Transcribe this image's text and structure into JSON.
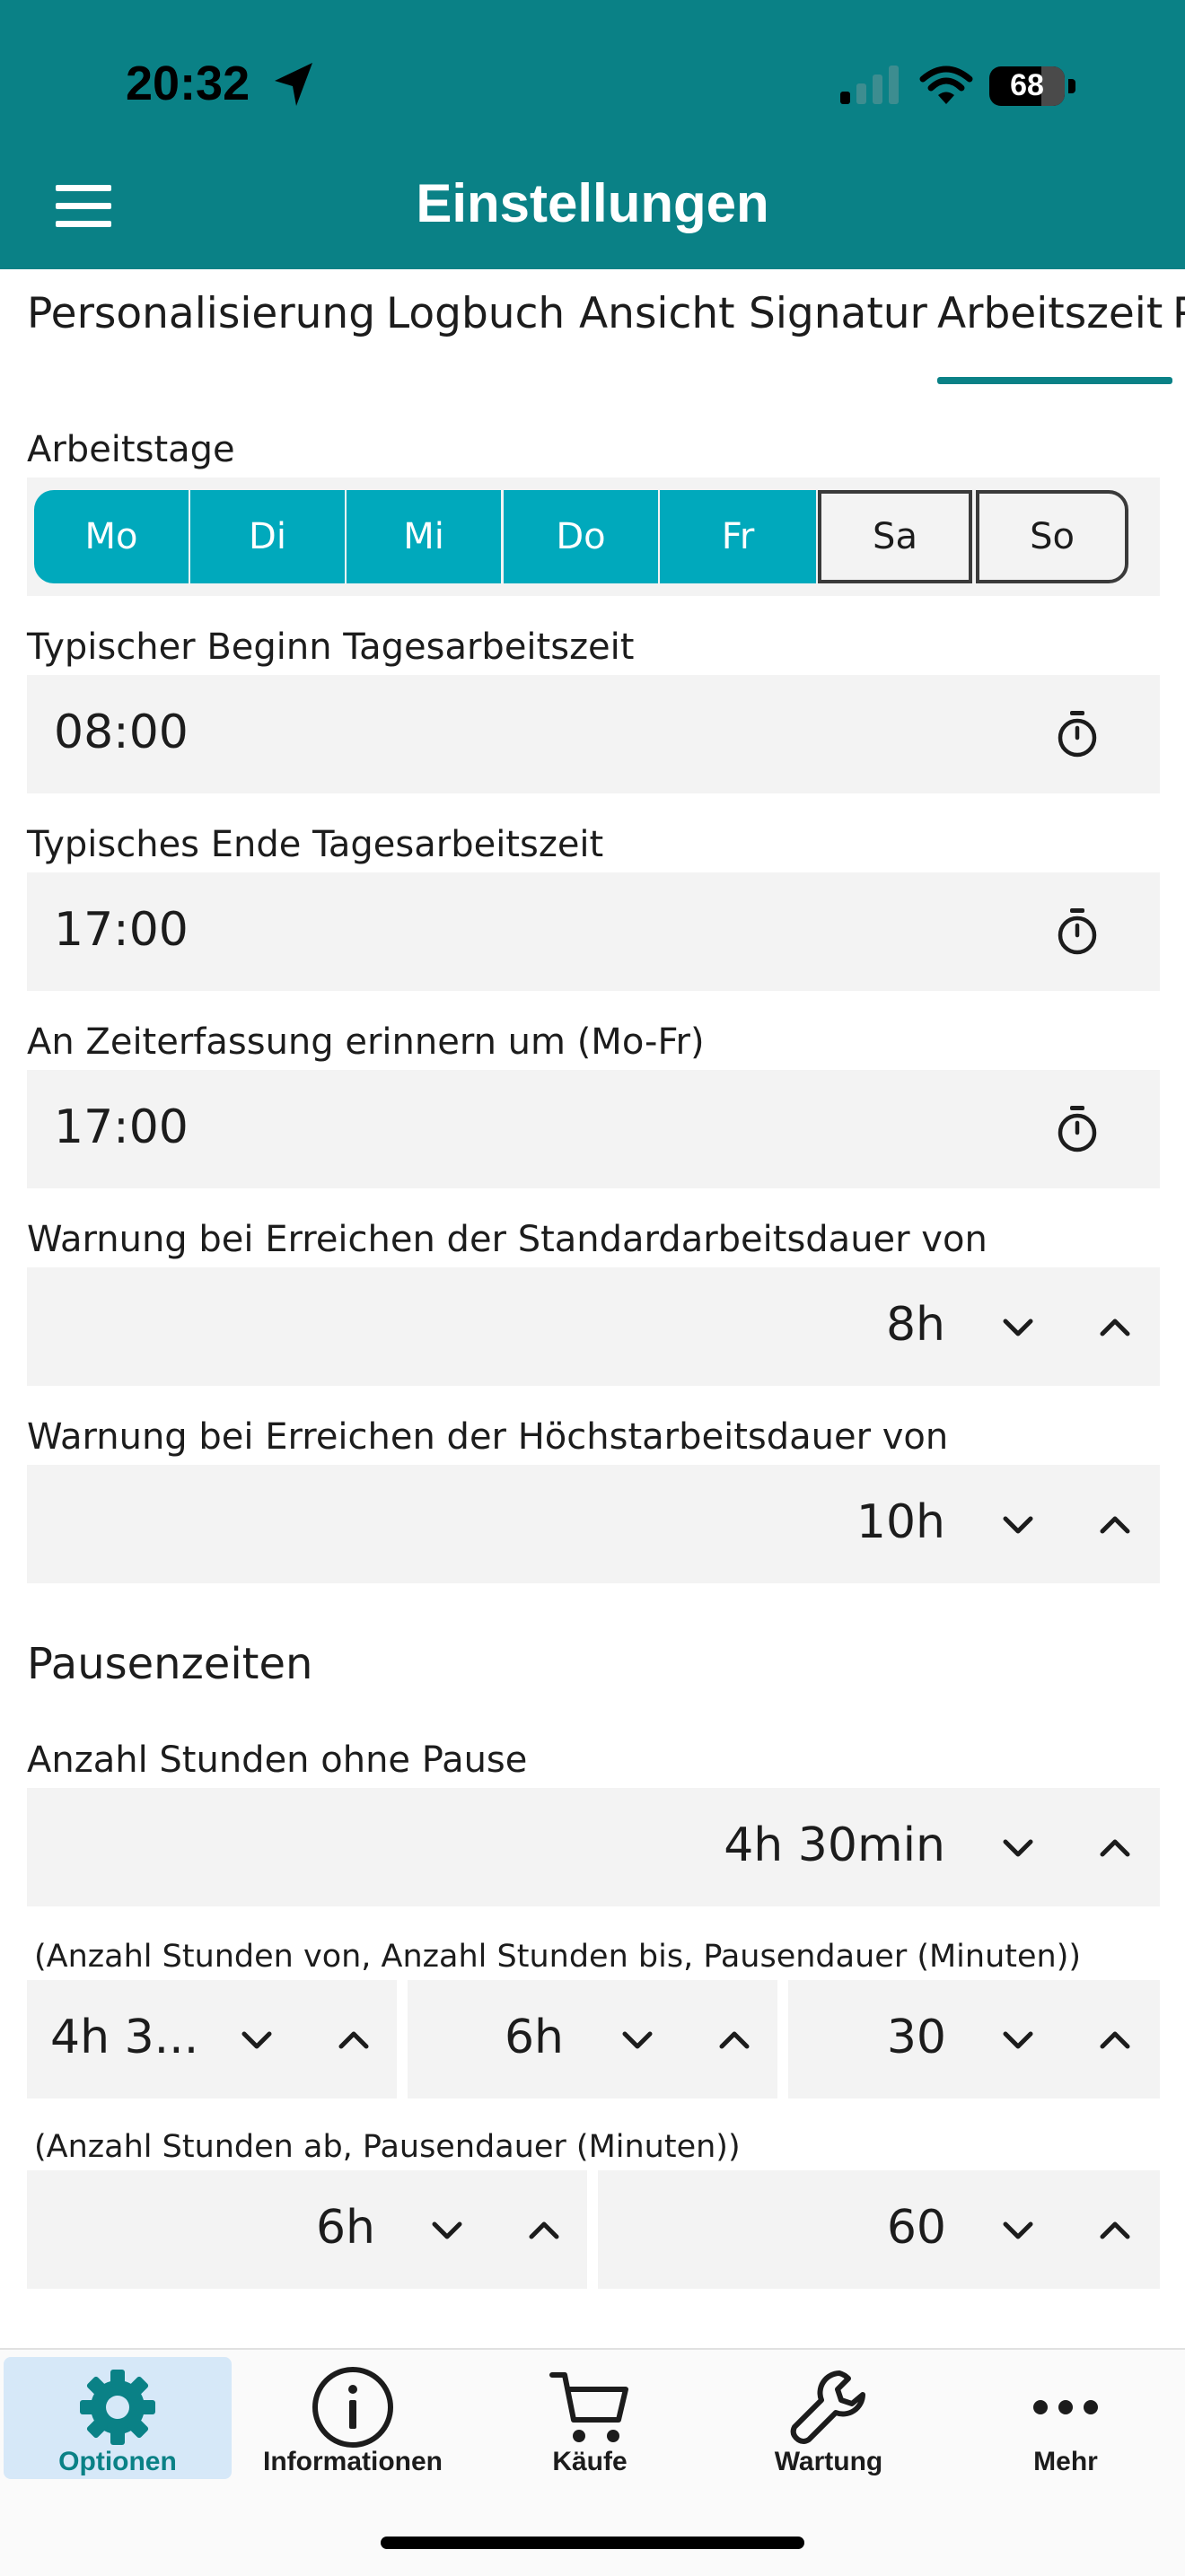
{
  "status_bar": {
    "time": "20:32",
    "battery": "68"
  },
  "header": {
    "title": "Einstellungen"
  },
  "tabs": [
    {
      "label": "Personalisierung"
    },
    {
      "label": "Logbuch"
    },
    {
      "label": "Ansicht"
    },
    {
      "label": "Signatur"
    },
    {
      "label": "Arbeitszeit",
      "active": true
    },
    {
      "label": "P"
    }
  ],
  "workdays": {
    "label": "Arbeitstage",
    "days": [
      {
        "label": "Mo",
        "selected": true
      },
      {
        "label": "Di",
        "selected": true
      },
      {
        "label": "Mi",
        "selected": true
      },
      {
        "label": "Do",
        "selected": true
      },
      {
        "label": "Fr",
        "selected": true
      },
      {
        "label": "Sa",
        "selected": false
      },
      {
        "label": "So",
        "selected": false
      }
    ]
  },
  "start_time": {
    "label": "Typischer Beginn Tagesarbeitszeit",
    "value": "08:00"
  },
  "end_time": {
    "label": "Typisches Ende Tagesarbeitszeit",
    "value": "17:00"
  },
  "reminder": {
    "label": "An Zeiterfassung erinnern um (Mo-Fr)",
    "value": "17:00"
  },
  "standard_warning": {
    "label": "Warnung bei Erreichen der Standardarbeitsdauer von",
    "value": "8h"
  },
  "max_warning": {
    "label": "Warnung bei Erreichen der Höchstarbeitsdauer von",
    "value": "10h"
  },
  "breaks": {
    "section_title": "Pausenzeiten",
    "no_break": {
      "label": "Anzahl Stunden ohne Pause",
      "value": "4h 30min"
    },
    "range_rule": {
      "label": "(Anzahl Stunden von, Anzahl Stunden bis, Pausendauer (Minuten))",
      "from": "4h 3...",
      "to": "6h",
      "minutes": "30"
    },
    "from_rule": {
      "label": "(Anzahl Stunden ab, Pausendauer (Minuten))",
      "from": "6h",
      "minutes": "60"
    }
  },
  "bottom_nav": {
    "items": [
      {
        "label": "Optionen",
        "icon": "gear-icon",
        "active": true
      },
      {
        "label": "Informationen",
        "icon": "info-icon"
      },
      {
        "label": "Käufe",
        "icon": "cart-icon"
      },
      {
        "label": "Wartung",
        "icon": "wrench-icon"
      },
      {
        "label": "Mehr",
        "icon": "more-icon"
      }
    ]
  },
  "colors": {
    "primary": "#0a8186",
    "accent": "#00a9bc",
    "field_bg": "#f3f3f3",
    "active_nav_bg": "#d6e8f8",
    "active_nav_fg": "#0a8186"
  }
}
